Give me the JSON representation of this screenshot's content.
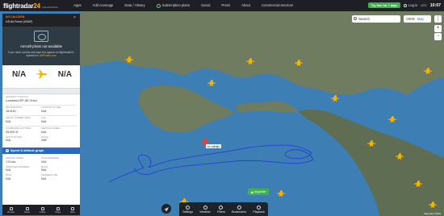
{
  "header": {
    "logo_text": "flightradar",
    "logo_num": "24",
    "logo_sub": "LIVE AIR TRAFFIC",
    "nav": [
      "Apps",
      "Add coverage",
      "Data / History",
      "Subscription plans",
      "Social",
      "Press",
      "About",
      "Commercial services"
    ],
    "trial_label": "Try free for 7 days",
    "login_label": "Log in",
    "utc_label": "UTC",
    "time": "10:07"
  },
  "search": {
    "placeholder": "Search"
  },
  "view": {
    "view_label": "VIEW",
    "map_label": "Map"
  },
  "panel": {
    "callsign": "NO CALLSIGN",
    "airline": "US Air Force (USAF)",
    "photo_title": "Aircraft photo not available",
    "photo_text": "If you have a photo and want it to appear on flightradar24, upload it to ",
    "photo_link": "JetPhotos.com",
    "origin": "N/A",
    "destination": "N/A",
    "aircraft_type_label": "AIRCRAFT TYPE (P3)",
    "aircraft_type": "Lockheed EP-3E Orion",
    "registration_label": "REGISTRATION",
    "registration": "161410",
    "country_label": "COUNTRY OF REG.",
    "country": "N/A",
    "serial_label": "SERIAL NUMBER (MSN)",
    "serial": "N/A",
    "age_label": "AGE",
    "age": "N/A",
    "cal_alt_label": "CALIBRATED ALTITUDE",
    "cal_alt": "26,900 ft",
    "vspeed_label": "VERTICAL SPEED",
    "vspeed": "N/A",
    "gps_alt_label": "GPS ALTITUDE",
    "gps_alt": "N/A",
    "track_label": "TRACK",
    "track": "258°",
    "graph_label": "Speed & altitude graph",
    "ground_speed_label": "GROUND SPEED",
    "ground_speed": "174 kts",
    "true_airspeed_label": "TRUE AIRSPEED",
    "true_airspeed": "N/A",
    "ind_airspeed_label": "INDICATED AIRSPEED",
    "ind_airspeed": "N/A",
    "mach_label": "MACH",
    "mach": "N/A",
    "wind_label": "WIND",
    "wind": "N/A",
    "temp_label": "TEMPERATURE",
    "temp": "N/A",
    "footer": [
      "3D view",
      "Route",
      "Follow",
      "Share",
      "More"
    ]
  },
  "toolbar": {
    "items": [
      "Settings",
      "Weather",
      "Filters",
      "Bookmarks",
      "Playback"
    ],
    "upgrade_label": "Upgrade"
  },
  "map": {
    "aircraft_tag": "No callsign",
    "scale_text": "Map data ©2023",
    "colors": {
      "sea": "#3d7fb4",
      "land": "#6f7c5f",
      "track": "#2733e0",
      "aircraft": "#f5b400"
    }
  }
}
